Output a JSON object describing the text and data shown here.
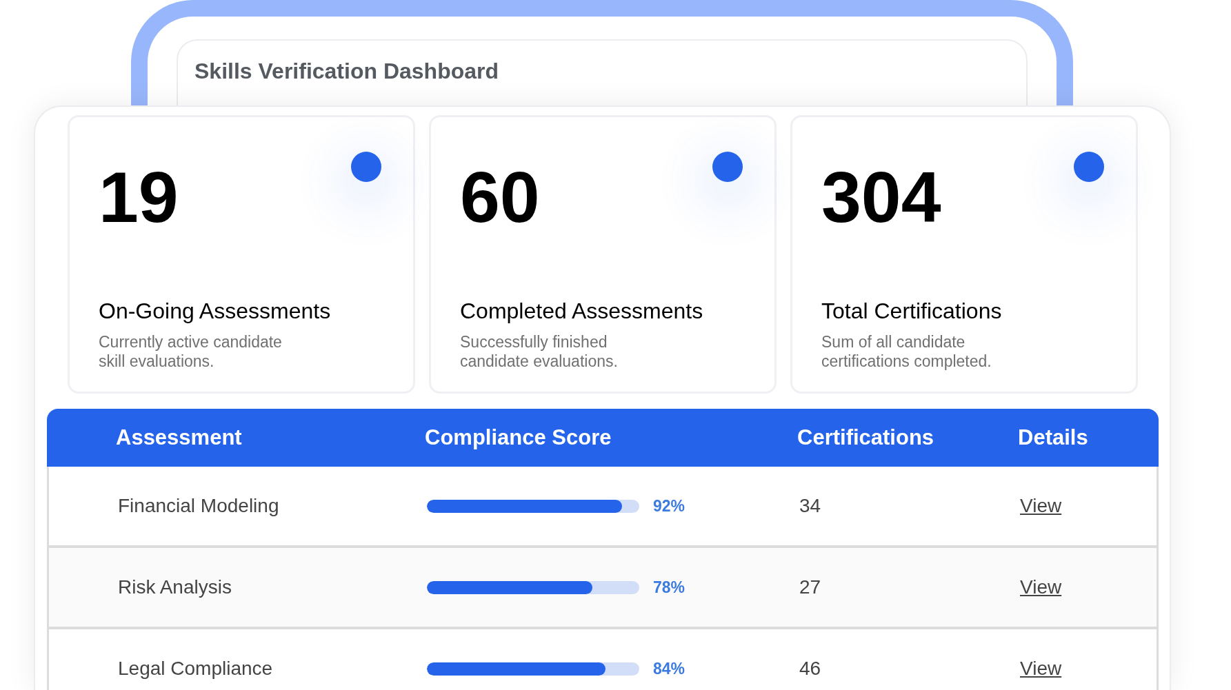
{
  "window": {
    "title": "Skills Verification Dashboard"
  },
  "stats": [
    {
      "value": "19",
      "title": "On-Going Assessments",
      "description": "Currently active candidate skill evaluations."
    },
    {
      "value": "60",
      "title": "Completed Assessments",
      "description": "Successfully finished candidate evaluations."
    },
    {
      "value": "304",
      "title": "Total Certifications",
      "description": "Sum of all candidate certifications completed."
    }
  ],
  "table": {
    "columns": [
      "Assessment",
      "Compliance Score",
      "Certifications",
      "Details"
    ],
    "rows": [
      {
        "assessment": "Financial Modeling",
        "level": 0.92,
        "score": "92%",
        "certifications": "34",
        "details": "View"
      },
      {
        "assessment": "Risk Analysis",
        "level": 0.78,
        "score": "78%",
        "certifications": "27",
        "details": "View"
      },
      {
        "assessment": "Legal Compliance",
        "level": 0.84,
        "score": "84%",
        "certifications": "46",
        "details": "View"
      }
    ]
  }
}
